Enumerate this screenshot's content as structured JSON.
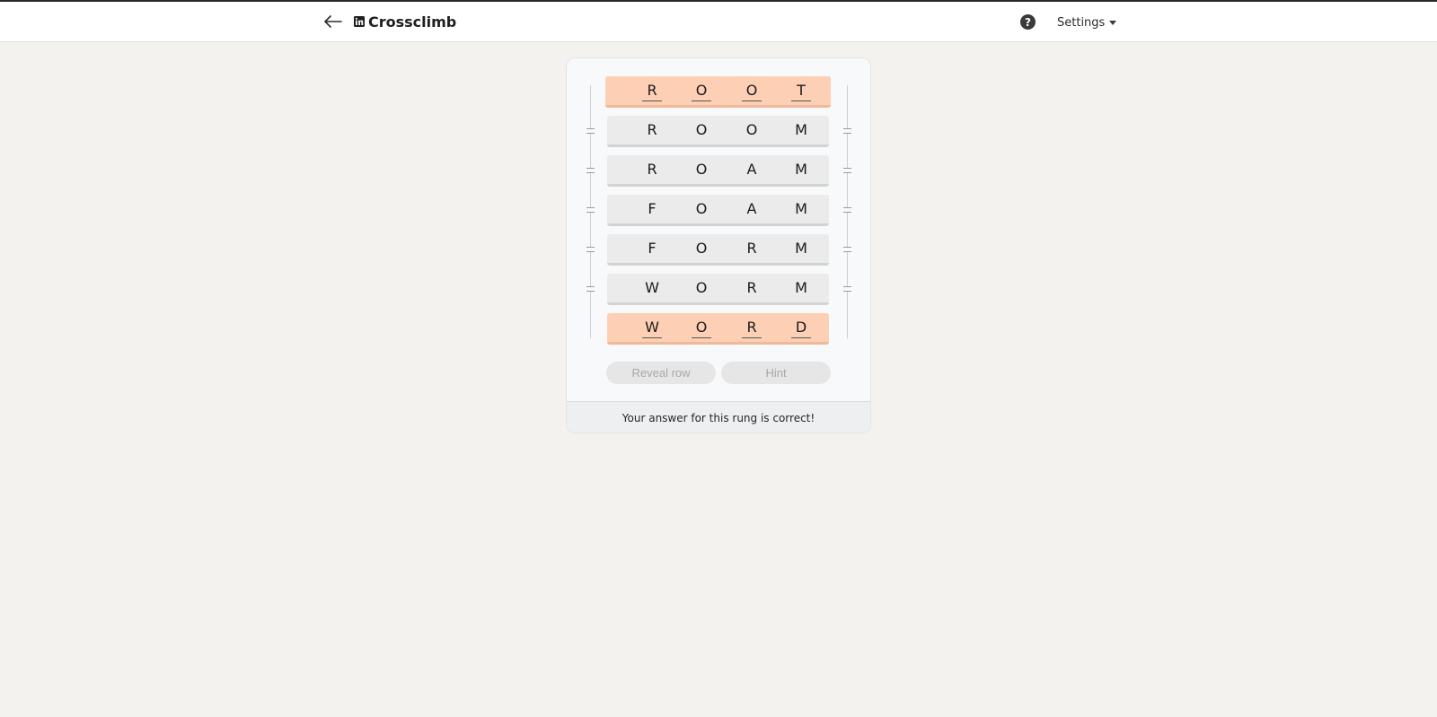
{
  "header": {
    "title": "Crossclimb",
    "back_icon": "arrow-left-icon",
    "logo_icon": "linkedin-logo-icon",
    "help_label": "?",
    "help_icon": "question-circle-icon",
    "settings_label": "Settings"
  },
  "ladder": {
    "rows": [
      {
        "word": "ROOT",
        "letters": [
          "R",
          "O",
          "O",
          "T"
        ],
        "state": "revealed-end"
      },
      {
        "word": "ROOM",
        "letters": [
          "R",
          "O",
          "O",
          "M"
        ],
        "state": "filled"
      },
      {
        "word": "ROAM",
        "letters": [
          "R",
          "O",
          "A",
          "M"
        ],
        "state": "filled"
      },
      {
        "word": "FOAM",
        "letters": [
          "F",
          "O",
          "A",
          "M"
        ],
        "state": "filled"
      },
      {
        "word": "FORM",
        "letters": [
          "F",
          "O",
          "R",
          "M"
        ],
        "state": "filled"
      },
      {
        "word": "WORM",
        "letters": [
          "W",
          "O",
          "R",
          "M"
        ],
        "state": "filled"
      },
      {
        "word": "WORD",
        "letters": [
          "W",
          "O",
          "R",
          "D"
        ],
        "state": "revealed-end"
      }
    ]
  },
  "buttons": {
    "reveal_row": "Reveal row",
    "hint": "Hint"
  },
  "status": {
    "message": "Your answer for this rung is correct!"
  },
  "colors": {
    "endcap_fill": "#fdcfb4",
    "rung_fill": "#ebebeb",
    "background": "#f3f2ef"
  }
}
